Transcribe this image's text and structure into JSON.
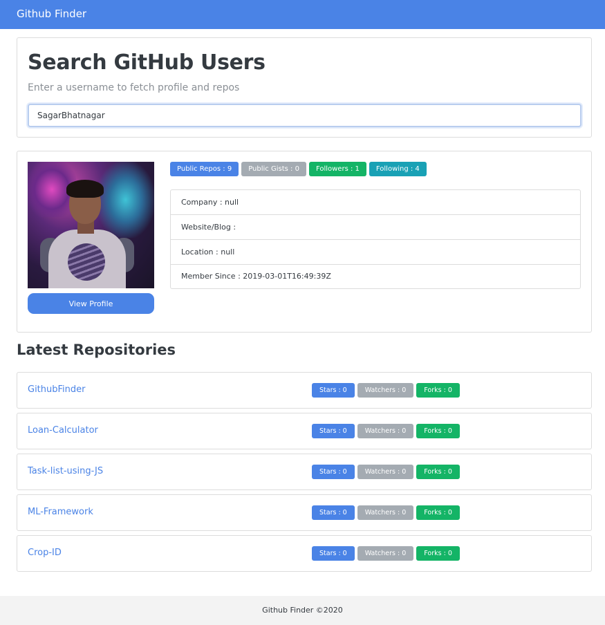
{
  "navbar": {
    "brand": "Github Finder"
  },
  "search": {
    "title": "Search GitHub Users",
    "subtitle": "Enter a username to fetch profile and repos",
    "value": "SagarBhatnagar"
  },
  "profile": {
    "view_profile_label": "View Profile",
    "badges": {
      "public_repos": "Public Repos : 9",
      "public_gists": "Public Gists : 0",
      "followers": "Followers : 1",
      "following": "Following : 4"
    },
    "info": {
      "company": "Company : null",
      "website": "Website/Blog :",
      "location": "Location : null",
      "member_since": "Member Since : 2019-03-01T16:49:39Z"
    }
  },
  "repos": {
    "heading": "Latest Repositories",
    "items": [
      {
        "name": "GithubFinder",
        "stars": "Stars : 0",
        "watchers": "Watchers : 0",
        "forks": "Forks : 0"
      },
      {
        "name": "Loan-Calculator",
        "stars": "Stars : 0",
        "watchers": "Watchers : 0",
        "forks": "Forks : 0"
      },
      {
        "name": "Task-list-using-JS",
        "stars": "Stars : 0",
        "watchers": "Watchers : 0",
        "forks": "Forks : 0"
      },
      {
        "name": "ML-Framework",
        "stars": "Stars : 0",
        "watchers": "Watchers : 0",
        "forks": "Forks : 0"
      },
      {
        "name": "Crop-ID",
        "stars": "Stars : 0",
        "watchers": "Watchers : 0",
        "forks": "Forks : 0"
      }
    ]
  },
  "footer": {
    "text": "Github Finder ©2020"
  },
  "colors": {
    "primary": "#4a83e6",
    "secondary": "#a4abb2",
    "success": "#14b466",
    "info": "#19a1b5"
  }
}
